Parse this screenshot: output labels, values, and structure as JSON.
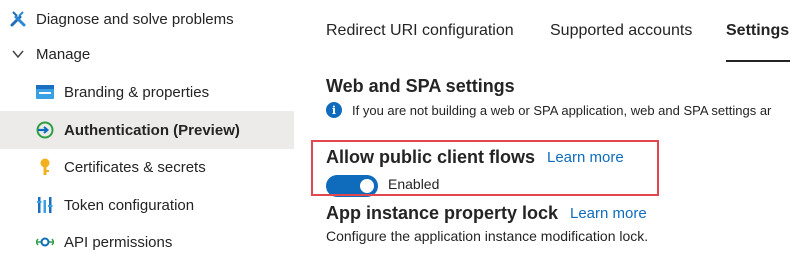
{
  "sidebar": {
    "items": [
      {
        "label": "Diagnose and solve problems",
        "icon": "wrench-icon"
      },
      {
        "label": "Manage",
        "icon": "chevron-down-icon"
      },
      {
        "label": "Branding & properties",
        "icon": "branding-icon"
      },
      {
        "label": "Authentication (Preview)",
        "icon": "authentication-icon",
        "active": true
      },
      {
        "label": "Certificates & secrets",
        "icon": "key-icon"
      },
      {
        "label": "Token configuration",
        "icon": "token-icon"
      },
      {
        "label": "API permissions",
        "icon": "api-permissions-icon"
      }
    ]
  },
  "tabs": [
    {
      "label": "Redirect URI configuration"
    },
    {
      "label": "Supported accounts"
    },
    {
      "label": "Settings",
      "selected": true
    }
  ],
  "web_spa": {
    "title": "Web and SPA settings",
    "info_text": "If you are not building a web or SPA application, web and SPA settings ar"
  },
  "public_client": {
    "title": "Allow public client flows",
    "learn_more": "Learn more",
    "toggle_label": "Enabled",
    "enabled": true
  },
  "instance_lock": {
    "title": "App instance property lock",
    "learn_more": "Learn more",
    "description": "Configure the application instance modification lock."
  },
  "colors": {
    "accent": "#0f6cbd",
    "highlight_border": "#e0474f",
    "active_nav_bg": "#edebe9"
  }
}
